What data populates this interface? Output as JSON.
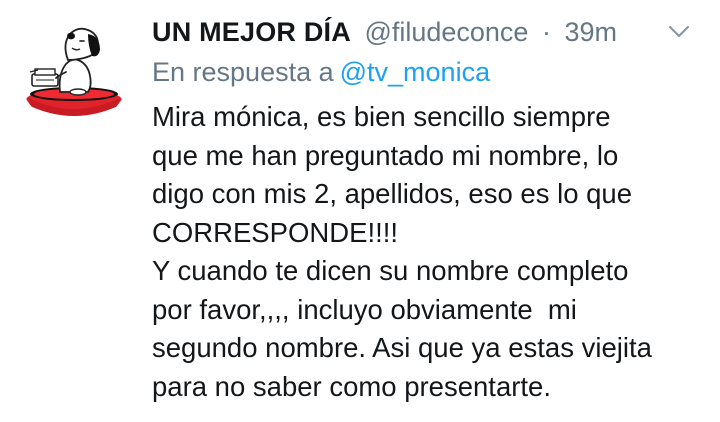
{
  "tweet": {
    "display_name": "UN MEJOR DÍA",
    "handle": "@filudeconce",
    "separator": "·",
    "timestamp": "39m",
    "reply_prefix": "En respuesta a",
    "reply_to": "@tv_monica",
    "body_lines": [
      "Mira mónica, es bien sencillo siempre",
      "que me han preguntado mi nombre, lo",
      "digo con mis 2, apellidos, eso es lo que",
      "CORRESPONDE!!!!",
      "Y cuando te dicen su nombre completo",
      "por favor,,,, incluyo obviamente  mi",
      "segundo nombre. Asi que ya estas viejita",
      "para no saber como presentarte."
    ]
  },
  "icons": {
    "avatar": "snoopy-typewriter-avatar",
    "menu": "chevron-down-icon"
  },
  "colors": {
    "text": "#14171a",
    "muted": "#657786",
    "link": "#1da1f2",
    "doghouse_red": "#e0222b"
  }
}
